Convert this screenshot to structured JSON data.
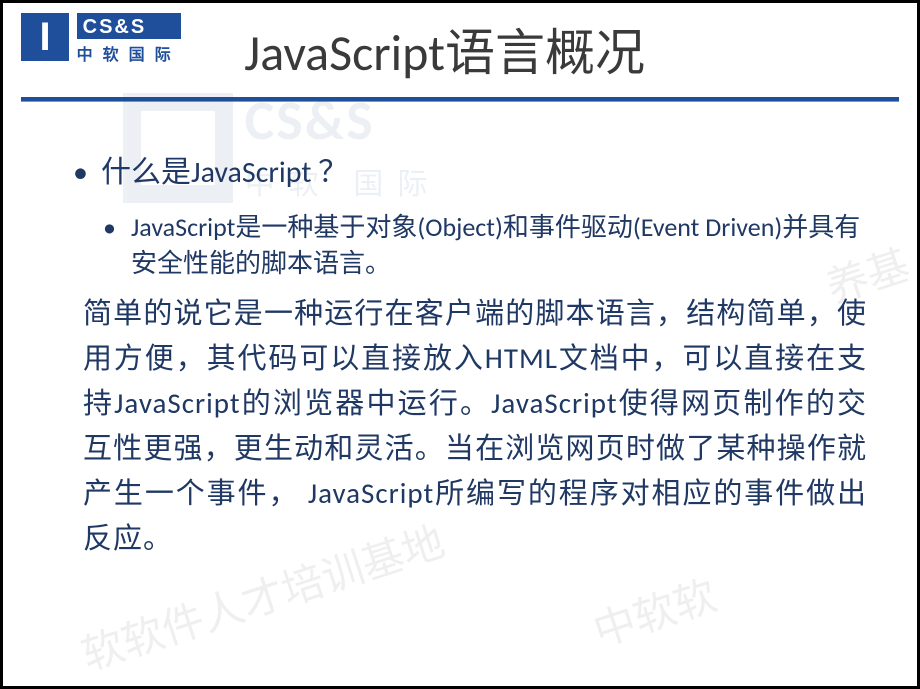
{
  "logo": {
    "box_letter": "I",
    "en": "CS&S",
    "cn": "中软国际"
  },
  "title": "JavaScript语言概况",
  "content": {
    "q": "什么是JavaScript ？",
    "def": "JavaScript是一种基于对象(Object)和事件驱动(Event Driven)并具有安全性能的脚本语言。",
    "para": "简单的说它是一种运行在客户端的脚本语言，结构简单，使用方便，其代码可以直接放入HTML文档中，可以直接在支持JavaScript的浏览器中运行。JavaScript使得网页制作的交互性更强，更生动和灵活。当在浏览网页时做了某种操作就产生一个事件， JavaScript所编写的程序对相应的事件做出反应。"
  },
  "watermark": {
    "box": "",
    "en": "CS&S",
    "cn": "中软 国际",
    "script1": "养基",
    "script2": "软软件人才培训基地",
    "script3": "中软软"
  }
}
